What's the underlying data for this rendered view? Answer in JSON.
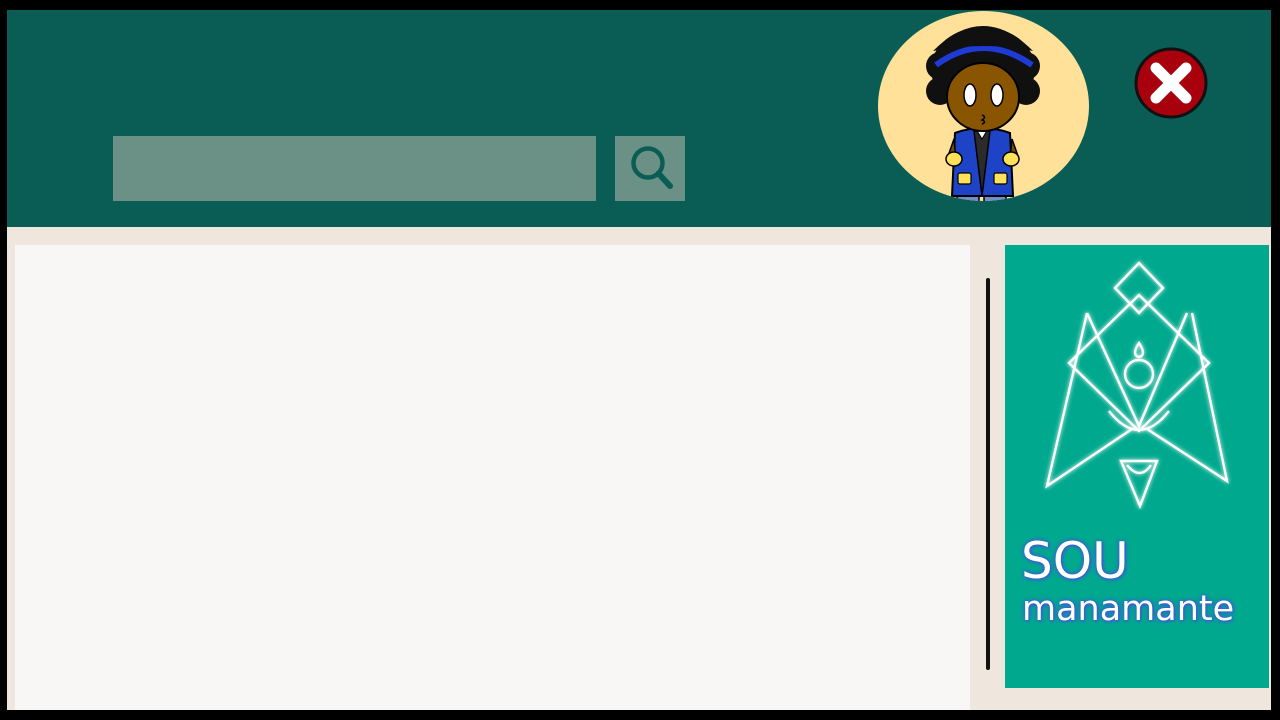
{
  "search": {
    "value": "",
    "placeholder": "",
    "button_icon": "search-icon"
  },
  "header": {
    "avatar_icon": "character-avatar",
    "close_icon": "close-icon"
  },
  "sidebar": {
    "brand_title": "SOU",
    "brand_subtitle": "manamante",
    "brand_logo": "emblem-logo"
  },
  "colors": {
    "header_bg": "#0a5d55",
    "card_bg": "#00a98e",
    "close_button": "#a8000d",
    "avatar_bg": "#ffe19a"
  }
}
